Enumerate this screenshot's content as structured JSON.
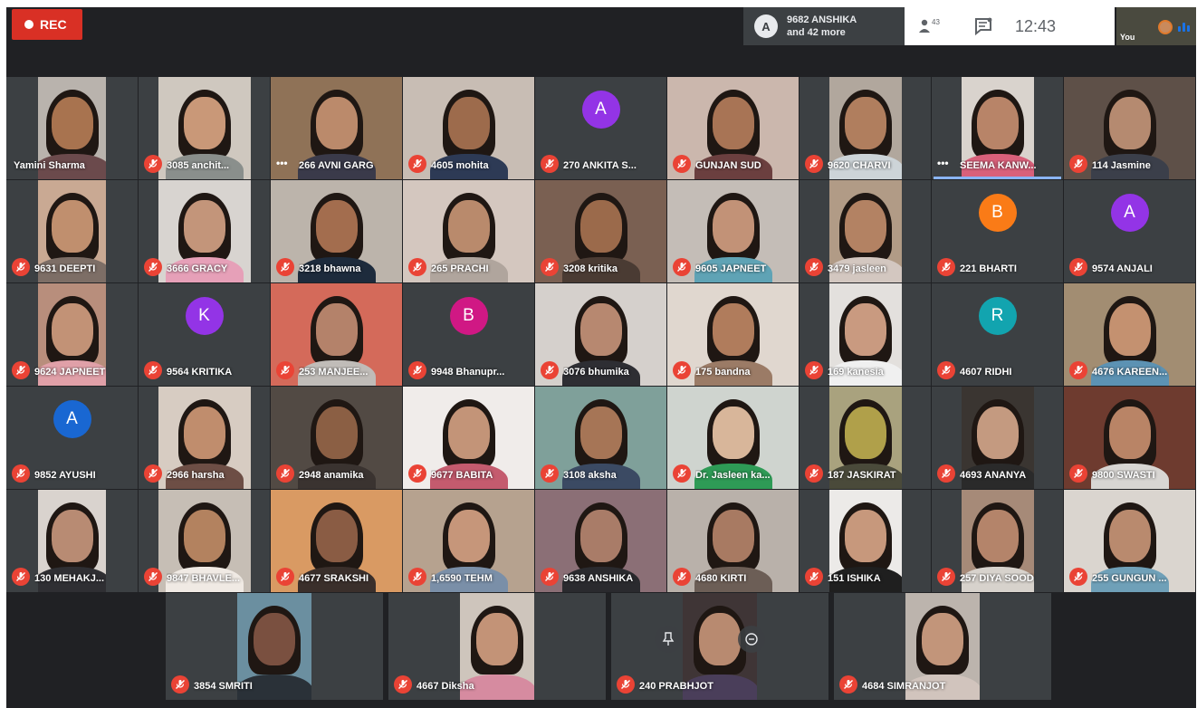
{
  "recording": {
    "label": "REC"
  },
  "presenter": {
    "avatar_letter": "A",
    "line1": "9682 ANSHIKA",
    "line2": "and 42 more"
  },
  "toolbar": {
    "people_count": "43",
    "time": "12:43",
    "self_label": "You"
  },
  "colors": {
    "muted_mic": "#ea4335",
    "speaking_bar": "#8ab4f8",
    "background": "#202124"
  },
  "participants": [
    {
      "name": "Yamini Sharma",
      "mic": "none",
      "video": true,
      "bg": "#b9b3ad",
      "skin": "#a8734f",
      "shirt": "#6b4a4c"
    },
    {
      "name": "3085 anchit...",
      "mic": "muted",
      "video": true,
      "bg": "#cfc8bf",
      "skin": "#c99878",
      "shirt": "#8a8f8c"
    },
    {
      "name": "266 AVNI GARG",
      "mic": "dots",
      "video": true,
      "bg": "#8f7257",
      "skin": "#bb8a6b",
      "shirt": "#3a3a4a"
    },
    {
      "name": "4605 mohita",
      "mic": "muted",
      "video": true,
      "bg": "#c8bdb4",
      "skin": "#9d6b4c",
      "shirt": "#2d3a55"
    },
    {
      "name": "270 ANKITA S...",
      "mic": "muted",
      "video": false,
      "avatar": "A",
      "avatar_color": "#9334e6"
    },
    {
      "name": "GUNJAN SUD",
      "mic": "muted",
      "video": true,
      "bg": "#cbb7ad",
      "skin": "#a87455",
      "shirt": "#6b3f3f"
    },
    {
      "name": "9620 CHARVI",
      "mic": "muted",
      "video": true,
      "bg": "#b1a79d",
      "skin": "#b07e5e",
      "shirt": "#cdd4d8"
    },
    {
      "name": "SEEMA KANW...",
      "mic": "dots",
      "video": true,
      "speaking": true,
      "bg": "#d9d3cd",
      "skin": "#b88468",
      "shirt": "#d9607a"
    },
    {
      "name": "114 Jasmine",
      "mic": "muted",
      "video": true,
      "bg": "#5e5048",
      "skin": "#b58a70",
      "shirt": "#3b3f4a"
    },
    {
      "name": "9631 DEEPTI",
      "mic": "muted",
      "video": true,
      "bg": "#c9a993",
      "skin": "#c08f6e",
      "shirt": "#7d6e66"
    },
    {
      "name": "3666 GRACY",
      "mic": "muted",
      "video": true,
      "bg": "#d8d4d0",
      "skin": "#c3957a",
      "shirt": "#e6a0b8"
    },
    {
      "name": "3218 bhawna",
      "mic": "muted",
      "video": true,
      "bg": "#bcb4ab",
      "skin": "#a36d4e",
      "shirt": "#1d2b3c"
    },
    {
      "name": "265 PRACHI",
      "mic": "muted",
      "video": true,
      "bg": "#d4c7bf",
      "skin": "#b98a6c",
      "shirt": "#b0a59d"
    },
    {
      "name": "3208 kritika",
      "mic": "muted",
      "video": true,
      "bg": "#7a6052",
      "skin": "#9b6a4b",
      "shirt": "#4a3b33"
    },
    {
      "name": "9605 JAPNEET",
      "mic": "muted",
      "video": true,
      "bg": "#c4bdb7",
      "skin": "#c29277",
      "shirt": "#5fa3b5"
    },
    {
      "name": "3479 jasleen",
      "mic": "muted",
      "video": true,
      "bg": "#b19b86",
      "skin": "#b38263",
      "shirt": "#d3c7c0"
    },
    {
      "name": "221 BHARTI",
      "mic": "muted",
      "video": false,
      "avatar": "B",
      "avatar_color": "#fa7b17"
    },
    {
      "name": "9574 ANJALI",
      "mic": "muted",
      "video": false,
      "avatar": "A",
      "avatar_color": "#9334e6"
    },
    {
      "name": "9624 JAPNEET",
      "mic": "muted",
      "video": true,
      "bg": "#b88e7c",
      "skin": "#c29276",
      "shirt": "#e0a0a8"
    },
    {
      "name": "9564 KRITIKA",
      "mic": "muted",
      "video": false,
      "avatar": "K",
      "avatar_color": "#9334e6"
    },
    {
      "name": "253 MANJEE...",
      "mic": "muted",
      "video": true,
      "bg": "#d46a5a",
      "skin": "#b4826a",
      "shirt": "#c0bcb8"
    },
    {
      "name": "9948 Bhanupr...",
      "mic": "muted",
      "video": false,
      "avatar": "B",
      "avatar_color": "#d01884"
    },
    {
      "name": "3076 bhumika",
      "mic": "muted",
      "video": true,
      "bg": "#d5d0cc",
      "skin": "#b78870",
      "shirt": "#2e2e33"
    },
    {
      "name": "175 bandna",
      "mic": "muted",
      "video": true,
      "bg": "#e0d7cf",
      "skin": "#b07c5c",
      "shirt": "#9b7b66"
    },
    {
      "name": "169 kanesia",
      "mic": "muted",
      "video": true,
      "bg": "#e3e0dd",
      "skin": "#c99a80",
      "shirt": "#f0f0f0"
    },
    {
      "name": "4607 RIDHI",
      "mic": "muted",
      "video": false,
      "avatar": "R",
      "avatar_color": "#12a4af"
    },
    {
      "name": "4676 KAREEN...",
      "mic": "muted",
      "video": true,
      "bg": "#a28d72",
      "skin": "#c49170",
      "shirt": "#5c92b3"
    },
    {
      "name": "9852 AYUSHI",
      "mic": "muted",
      "video": false,
      "avatar": "A",
      "avatar_color": "#1967d2"
    },
    {
      "name": "2966 harsha",
      "mic": "muted",
      "video": true,
      "bg": "#d7ccc2",
      "skin": "#c08d6d",
      "shirt": "#6d4e45"
    },
    {
      "name": "2948 anamika",
      "mic": "muted",
      "video": true,
      "bg": "#524a44",
      "skin": "#8b5f44",
      "shirt": "#3a3330"
    },
    {
      "name": "9677 BABITA",
      "mic": "muted",
      "video": true,
      "bg": "#f0ecea",
      "skin": "#c39478",
      "shirt": "#c45b6e"
    },
    {
      "name": "3108 aksha",
      "mic": "muted",
      "video": true,
      "bg": "#7fa09a",
      "skin": "#a67556",
      "shirt": "#3b4a63"
    },
    {
      "name": "Dr. Jasleen ka...",
      "mic": "muted",
      "video": true,
      "bg": "#cfd4cf",
      "skin": "#d8b69a",
      "shirt": "#2e9b56"
    },
    {
      "name": "187 JASKIRAT",
      "mic": "muted",
      "video": true,
      "bg": "#a9a27e",
      "skin": "#b0a04a",
      "shirt": "#4a4a3a"
    },
    {
      "name": "4693 ANANYA",
      "mic": "muted",
      "video": true,
      "bg": "#3a3531",
      "skin": "#c49a80",
      "shirt": "#2a2a2a"
    },
    {
      "name": "9800 SWASTI",
      "mic": "muted",
      "video": true,
      "bg": "#6e3b2f",
      "skin": "#b98466",
      "shirt": "#d8d6d3"
    },
    {
      "name": "130 MEHAKJ...",
      "mic": "muted",
      "video": true,
      "bg": "#d9d3ce",
      "skin": "#b88b73",
      "shirt": "#2f2f33"
    },
    {
      "name": "9847 BHAVLE...",
      "mic": "muted",
      "video": true,
      "bg": "#c6beb5",
      "skin": "#b3825f",
      "shirt": "#f0eae4"
    },
    {
      "name": "4677 SRAKSHI",
      "mic": "muted",
      "video": true,
      "bg": "#d99a63",
      "skin": "#8a5c44",
      "shirt": "#3a2f2b"
    },
    {
      "name": "1,6590 TEHM",
      "mic": "muted",
      "video": true,
      "bg": "#b6a28f",
      "skin": "#c6967a",
      "shirt": "#7a8fa8"
    },
    {
      "name": "9638 ANSHIKA",
      "mic": "muted",
      "video": true,
      "bg": "#8b6f76",
      "skin": "#a97c68",
      "shirt": "#2a2a2e"
    },
    {
      "name": "4680 KIRTI",
      "mic": "muted",
      "video": true,
      "bg": "#b9b1aa",
      "skin": "#a87a62",
      "shirt": "#6c5e56"
    },
    {
      "name": "151 ISHIKA",
      "mic": "muted",
      "video": true,
      "bg": "#eceae8",
      "skin": "#c7987c",
      "shirt": "#1f1f1f"
    },
    {
      "name": "257 DIYA SOOD",
      "mic": "muted",
      "video": true,
      "bg": "#a68a78",
      "skin": "#b4846a",
      "shirt": "#d7d2cc"
    },
    {
      "name": "255 GUNGUN ...",
      "mic": "muted",
      "video": true,
      "bg": "#dad5cf",
      "skin": "#b98a6e",
      "shirt": "#6fa0b8"
    },
    {
      "name": "3854 SMRITI",
      "mic": "muted",
      "video": true,
      "bg": "#6b8fa0",
      "skin": "#7a5040",
      "shirt": "#2a3138"
    },
    {
      "name": "4667 Diksha",
      "mic": "muted",
      "video": true,
      "bg": "#cec5bc",
      "skin": "#c39377",
      "shirt": "#d68ba0"
    },
    {
      "name": "240 PRABHJOT",
      "mic": "muted",
      "video": true,
      "bg": "#3f3536",
      "skin": "#b88a70",
      "shirt": "#4a3e5a"
    },
    {
      "name": "4684 SIMRANJOT",
      "mic": "muted",
      "video": true,
      "bg": "#bcb4ad",
      "skin": "#c2957a",
      "shirt": "#d1c4bd"
    }
  ]
}
